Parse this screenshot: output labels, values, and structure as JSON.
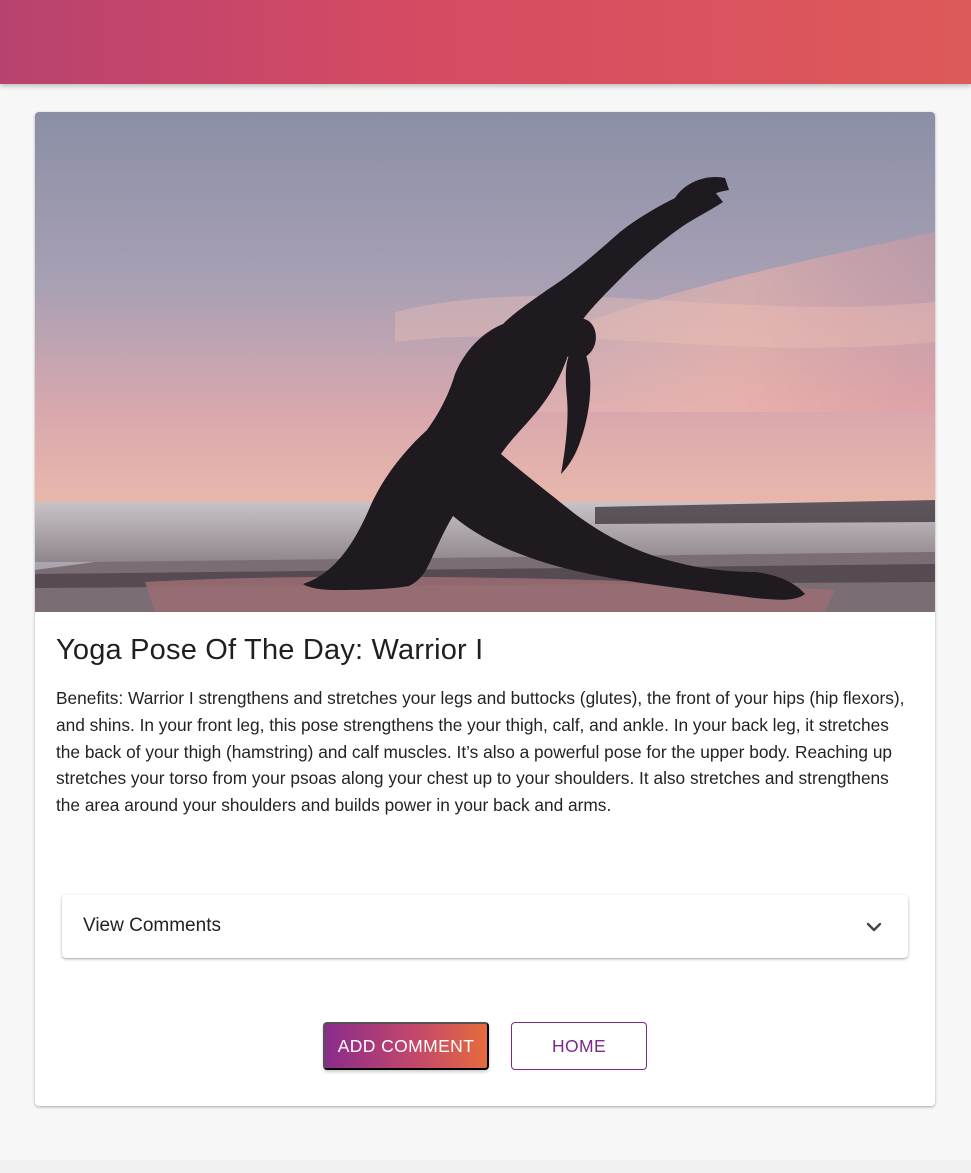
{
  "post": {
    "image_alt": "Silhouette of a woman in a yoga lunge pose at sunset by the sea",
    "title": "Yoga Pose Of The Day: Warrior I",
    "body": "Benefits: Warrior I strengthens and stretches your legs and buttocks (glutes), the front of your hips (hip flexors), and shins. In your front leg, this pose strengthens the your thigh, calf, and ankle. In your back leg, it stretches the back of your thigh (hamstring) and calf muscles. It’s also a powerful pose for the upper body. Reaching up stretches your torso from your psoas along your chest up to your shoulders. It also stretches and strengthens the area around your shoulders and builds power in your back and arms."
  },
  "comments": {
    "toggle_label": "View Comments",
    "icon": "chevron-down-icon"
  },
  "actions": {
    "add_comment_label": "ADD COMMENT",
    "home_label": "HOME"
  },
  "colors": {
    "app_bar_start": "#b8426f",
    "app_bar_end": "#dd5a5a",
    "primary": "#7b2a86",
    "accent": "#e66b3d"
  }
}
